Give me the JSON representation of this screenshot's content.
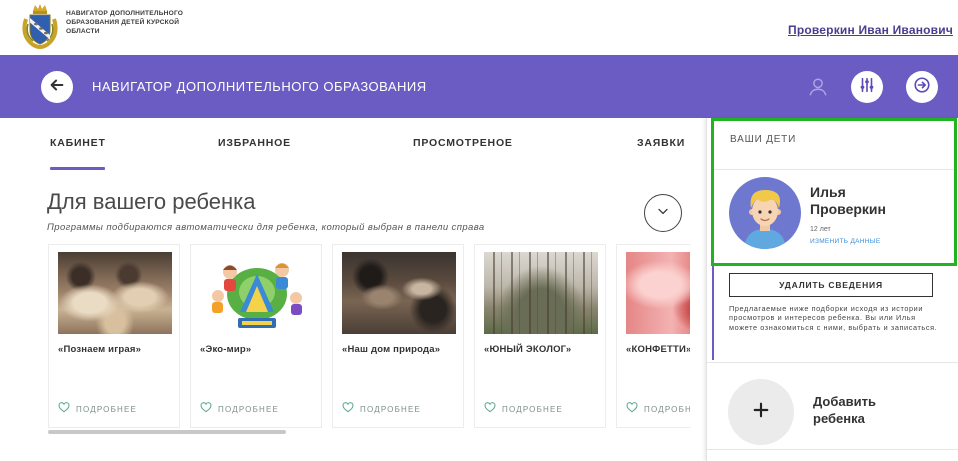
{
  "header": {
    "org_name_lines": [
      "НАВИГАТОР ДОПОЛНИТЕЛЬНОГО",
      "ОБРАЗОВАНИЯ ДЕТЕЙ КУРСКОЙ",
      "ОБЛАСТИ"
    ],
    "user_name": "Проверкин Иван Иванович"
  },
  "topbar": {
    "title": "НАВИГАТОР ДОПОЛНИТЕЛЬНОГО ОБРАЗОВАНИЯ"
  },
  "icons": {
    "logo": "coat-of-arms-logo",
    "back": "arrow-left-icon",
    "user": "user-icon",
    "filter": "sliders-icon",
    "logout": "logout-icon",
    "collapse": "chevron-down-icon",
    "favorite": "heart-icon",
    "add": "plus-icon"
  },
  "tabs": [
    {
      "label": "КАБИНЕТ",
      "active": true
    },
    {
      "label": "ИЗБРАННОЕ",
      "active": false
    },
    {
      "label": "ПРОСМОТРЕНОЕ",
      "active": false
    },
    {
      "label": "ЗАЯВКИ",
      "active": false
    }
  ],
  "recommendations": {
    "title": "Для вашего ребенка",
    "subtitle": "Программы подбираются автоматически для ребенка, который выбран в панели справа",
    "details_label": "ПОДРОБНЕЕ",
    "cards": [
      {
        "title": "«Познаем играя»"
      },
      {
        "title": "«Эко-мир»"
      },
      {
        "title": "«Наш дом природа»"
      },
      {
        "title": "«ЮНЫЙ ЭКОЛОГ»"
      },
      {
        "title": "«КОНФЕТТИ»"
      }
    ]
  },
  "children_panel": {
    "heading": "ВАШИ ДЕТИ",
    "child": {
      "first_name": "Илья",
      "last_name": "Проверкин",
      "age": "12 лет",
      "edit_link": "ИЗМЕНИТЬ ДАННЫЕ"
    },
    "delete_button": "УДАЛИТЬ СВЕДЕНИЯ",
    "note": "Предлагаемые ниже подборки исходя из истории просмотров и интересов ребенка. Вы или Илья можете ознакомиться с ними, выбрать и записаться.",
    "add_child": {
      "line1": "Добавить",
      "line2": "ребенка"
    }
  },
  "colors": {
    "primary": "#6b5cc4",
    "highlight": "#22b322",
    "link": "#4b3c8f",
    "details": "#5aa993",
    "edit_link": "#3d8fd8"
  }
}
